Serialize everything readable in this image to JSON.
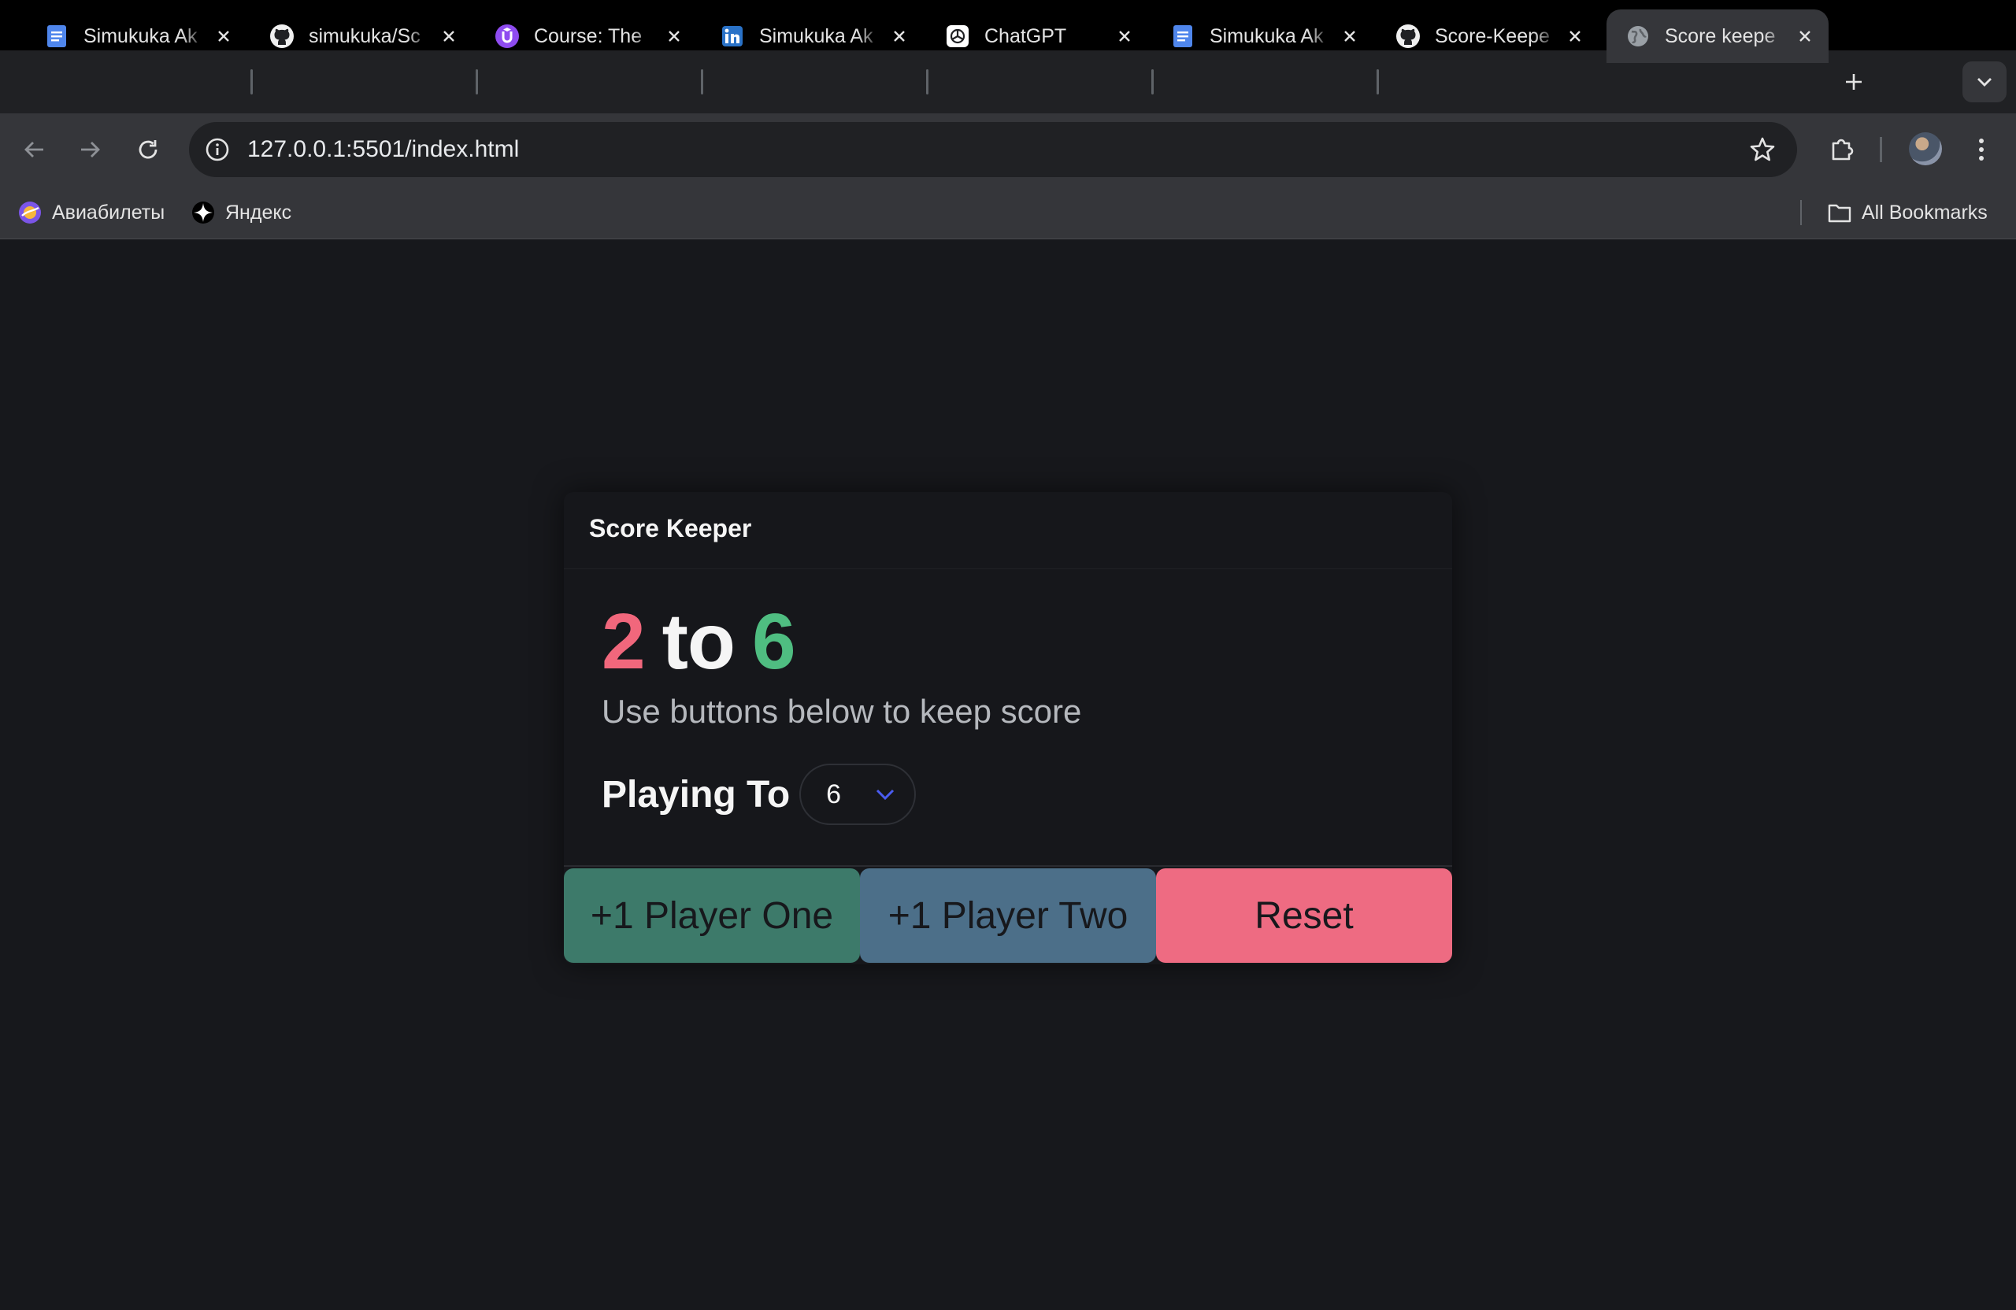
{
  "browser": {
    "tabs": [
      {
        "title": "Simukuka Ak",
        "icon": "google-docs-icon"
      },
      {
        "title": "simukuka/Sc",
        "icon": "github-icon"
      },
      {
        "title": "Course: The",
        "icon": "udemy-icon"
      },
      {
        "title": "Simukuka Ak",
        "icon": "linkedin-icon"
      },
      {
        "title": "ChatGPT",
        "icon": "chatgpt-icon"
      },
      {
        "title": "Simukuka Ak",
        "icon": "google-docs-icon"
      },
      {
        "title": "Score-Keepe",
        "icon": "github-icon"
      },
      {
        "title": "Score keepe",
        "icon": "globe-icon",
        "active": true
      }
    ],
    "url": "127.0.0.1:5501/index.html",
    "bookmarks": [
      {
        "label": "Авиабилеты",
        "icon": "aviasales-icon"
      },
      {
        "label": "Яндекс",
        "icon": "yandex-icon"
      }
    ],
    "all_bookmarks_label": "All Bookmarks"
  },
  "app": {
    "header_title": "Score Keeper",
    "score": {
      "player_one": "2",
      "separator": "to",
      "player_two": "6"
    },
    "subtitle": "Use buttons below to keep score",
    "playing_to_label": "Playing To",
    "playing_to_value": "6",
    "buttons": {
      "player_one": "+1 Player One",
      "player_two": "+1 Player Two",
      "reset": "Reset"
    }
  },
  "colors": {
    "player_one": "#f1677c",
    "player_two": "#4fbd81",
    "btn_player_one": "#3d7a6a",
    "btn_player_two": "#4c6f89",
    "btn_reset": "#ee6b82"
  }
}
